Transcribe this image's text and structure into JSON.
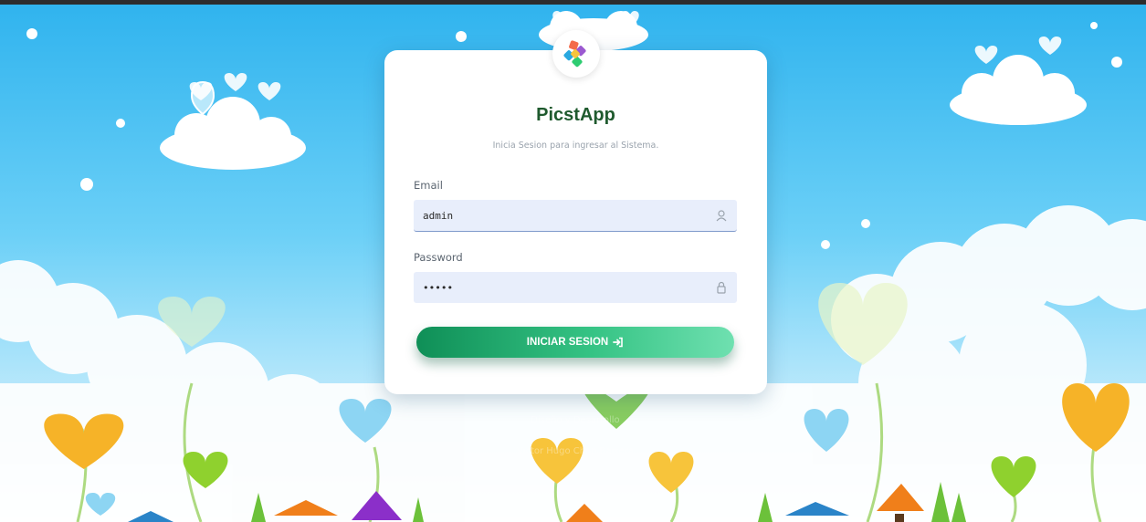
{
  "app": {
    "title": "PicstApp",
    "subtitle": "Inicia Sesion para ingresar al Sistema."
  },
  "form": {
    "email_label": "Email",
    "email_value": "admin",
    "password_label": "Password",
    "password_value": "admin",
    "submit_label": "INICIAR SESION"
  },
  "footer": {
    "line1": "Diseño y Desarrollo",
    "line2": "Victor Hugo Chan Barrera"
  },
  "icons": {
    "email_field": "user-icon",
    "password_field": "lock-icon",
    "submit": "sign-in-icon",
    "logo": "picstapp-logo"
  },
  "colors": {
    "title": "#1f5a2e",
    "button_start": "#0f8f57",
    "button_end": "#6fe0b0",
    "field_bg": "#e8eefb"
  }
}
